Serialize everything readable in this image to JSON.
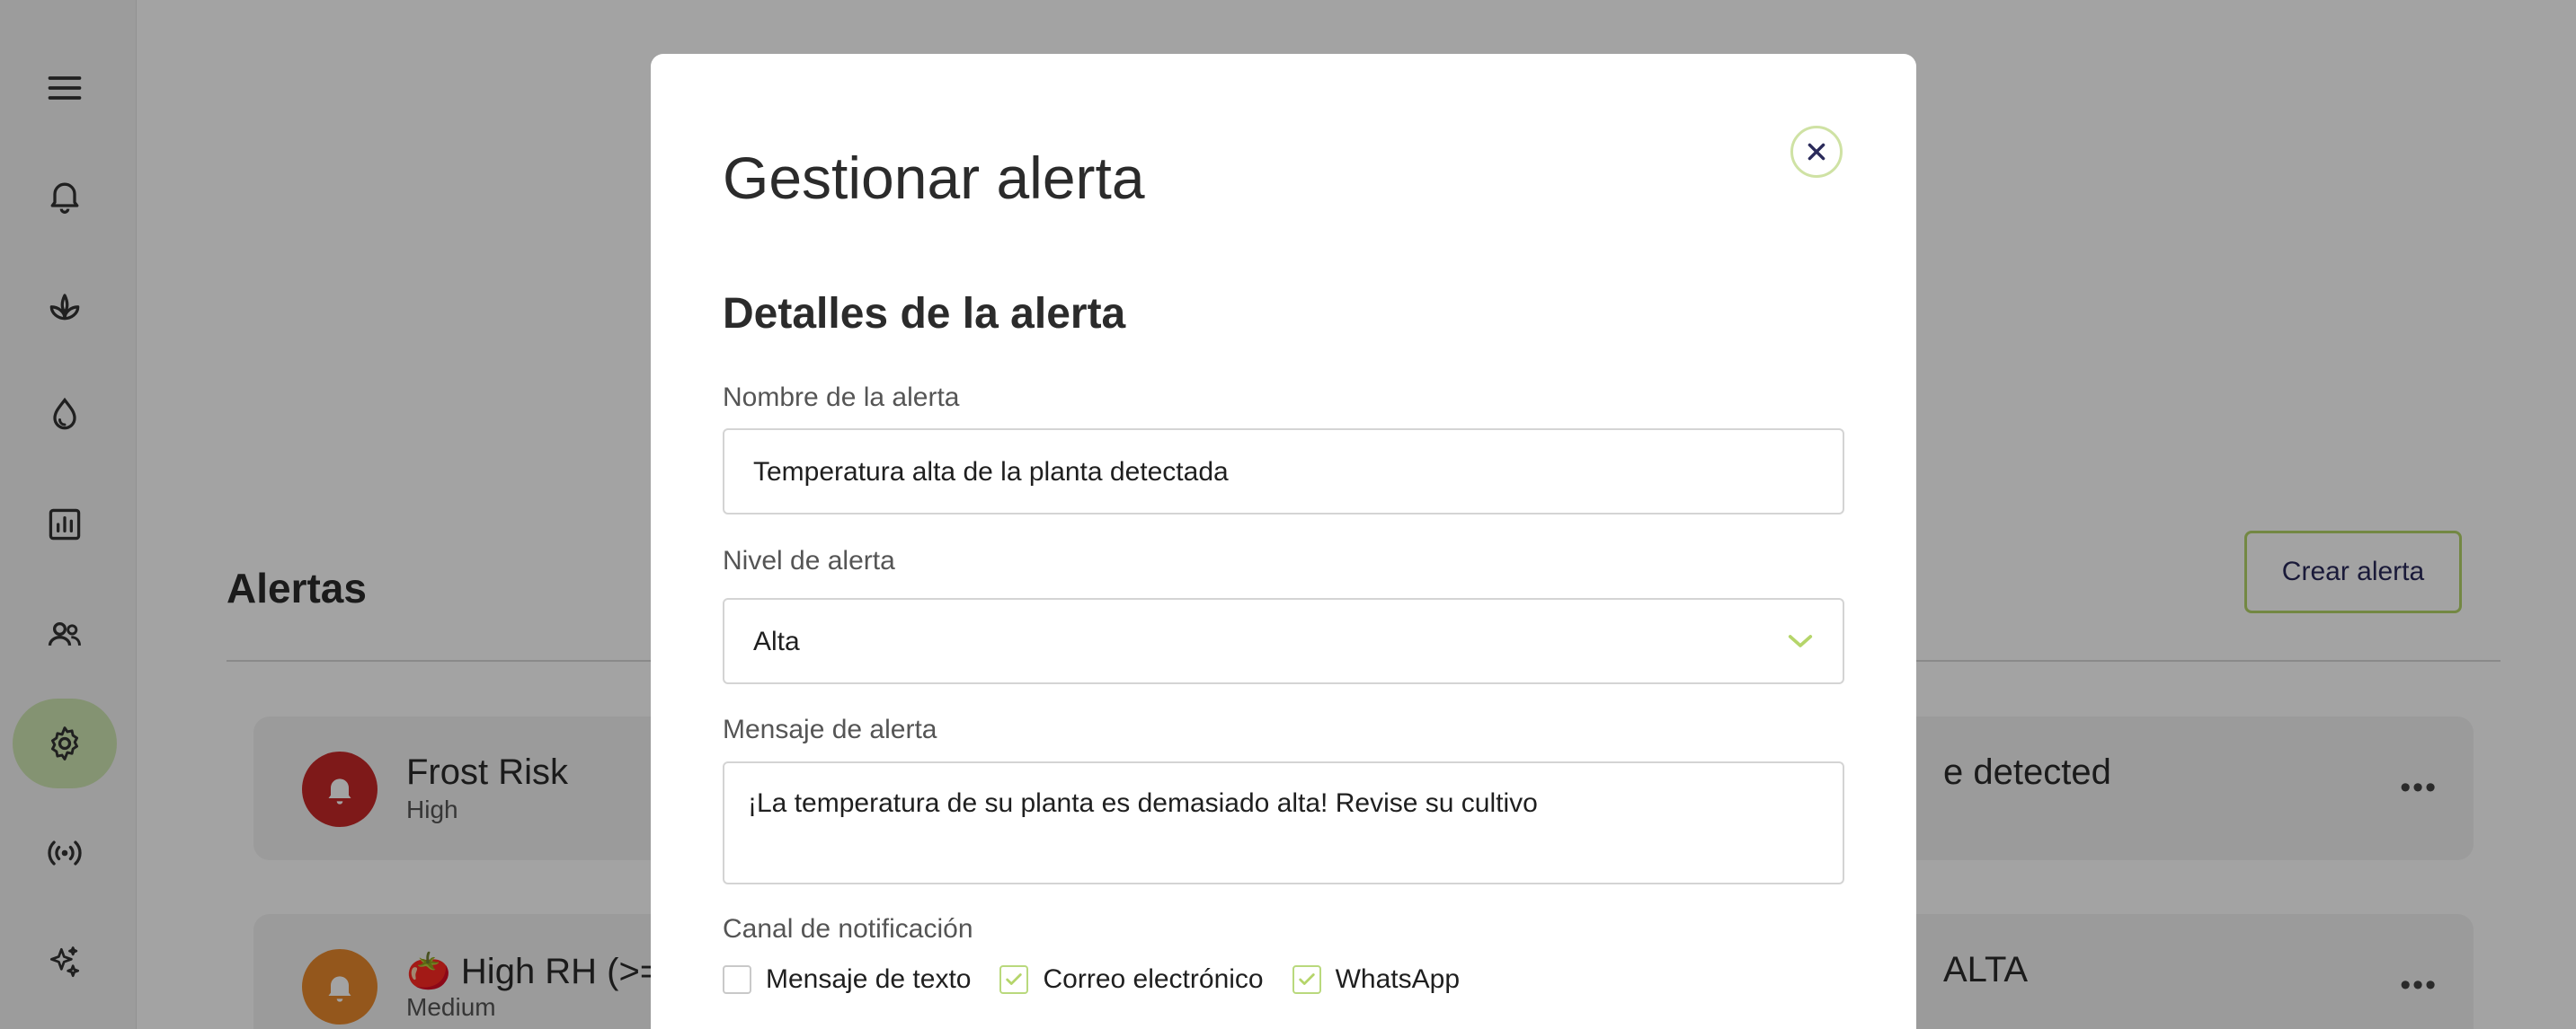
{
  "sidebar": {
    "items": [
      {
        "icon": "menu-icon"
      },
      {
        "icon": "bell-icon"
      },
      {
        "icon": "plant-icon"
      },
      {
        "icon": "water-drop-icon"
      },
      {
        "icon": "chart-icon"
      },
      {
        "icon": "users-icon"
      },
      {
        "icon": "gear-icon",
        "active": true
      },
      {
        "icon": "broadcast-icon"
      },
      {
        "icon": "sparkles-icon"
      }
    ],
    "active_color": "#cfe7b3"
  },
  "page": {
    "title": "Alertas",
    "create_button": "Crear alerta",
    "alerts": [
      {
        "name": "Frost Risk",
        "level": "High",
        "right_text": "e detected",
        "badge_color": "#c62828"
      },
      {
        "name": "🍅 High RH (>=",
        "level": "Medium",
        "right_text": "ALTA",
        "badge_color": "#e8892c"
      }
    ],
    "more_label": "•••"
  },
  "modal": {
    "title": "Gestionar alerta",
    "section_title": "Detalles de la alerta",
    "name_label": "Nombre de la alerta",
    "name_value": "Temperatura alta de la planta detectada",
    "level_label": "Nivel de alerta",
    "level_value": "Alta",
    "message_label": "Mensaje de alerta",
    "message_value": "¡La temperatura de su planta es demasiado alta! Revise su cultivo",
    "channel_label": "Canal de notificación",
    "channels": [
      {
        "label": "Mensaje de texto",
        "checked": false
      },
      {
        "label": "Correo electrónico",
        "checked": true
      },
      {
        "label": "WhatsApp",
        "checked": true
      }
    ],
    "accent_color": "#b5d56a"
  }
}
